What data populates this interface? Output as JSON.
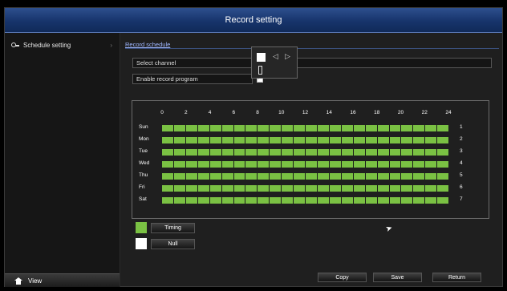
{
  "window": {
    "title": "Record setting"
  },
  "sidebar": {
    "items": [
      {
        "label": "Schedule setting",
        "icon": "key-icon"
      }
    ],
    "view_button": {
      "label": "View",
      "icon": "home-icon"
    }
  },
  "main": {
    "tab": "Record schedule",
    "select_channel": {
      "label": "Select channel"
    },
    "enable_record": {
      "label": "Enable record program",
      "checked": true
    },
    "schedule": {
      "hours": [
        "0",
        "2",
        "4",
        "6",
        "8",
        "10",
        "12",
        "14",
        "16",
        "18",
        "20",
        "22",
        "24"
      ],
      "days": [
        {
          "name": "Sun",
          "num": "1"
        },
        {
          "name": "Mon",
          "num": "2"
        },
        {
          "name": "Tue",
          "num": "3"
        },
        {
          "name": "Wed",
          "num": "4"
        },
        {
          "name": "Thu",
          "num": "5"
        },
        {
          "name": "Fri",
          "num": "6"
        },
        {
          "name": "Sat",
          "num": "7"
        }
      ],
      "slots_per_day": 24,
      "fill_color": "#7ac143"
    },
    "legend": [
      {
        "label": "Timing",
        "color": "#7ac143"
      },
      {
        "label": "Null",
        "color": "#ffffff"
      }
    ],
    "buttons": {
      "copy": "Copy",
      "save": "Save",
      "return": "Return"
    }
  }
}
